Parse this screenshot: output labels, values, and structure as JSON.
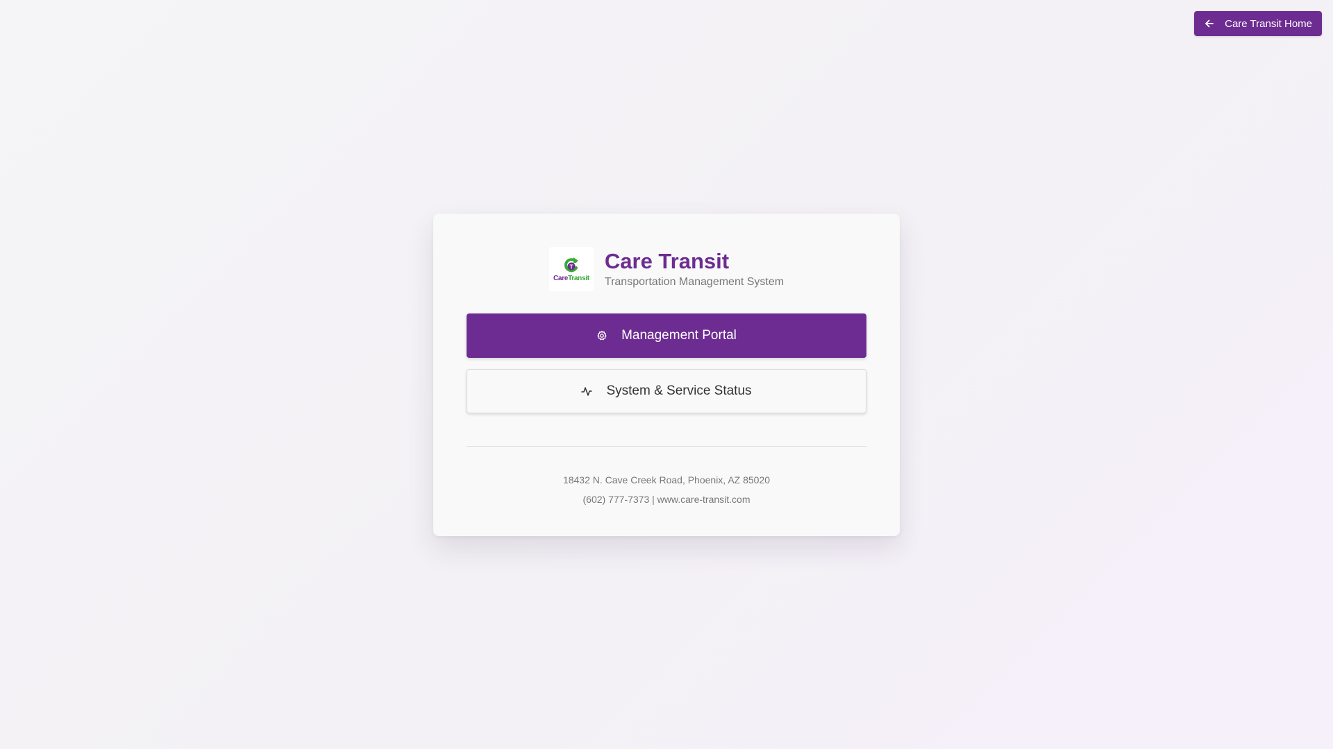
{
  "header": {
    "home_button_label": "Care Transit Home",
    "home_button_icon": "arrow-left-icon"
  },
  "brand": {
    "logo_text_care": "Care",
    "logo_text_transit": "Transit",
    "title": "Care Transit",
    "subtitle": "Transportation Management System"
  },
  "actions": {
    "management_portal": {
      "label": "Management Portal",
      "icon": "gear-icon"
    },
    "system_status": {
      "label": "System & Service Status",
      "icon": "activity-icon"
    }
  },
  "footer": {
    "address": "18432 N. Cave Creek Road, Phoenix, AZ 85020",
    "contact": "(602) 777-7373 | www.care-transit.com"
  },
  "colors": {
    "brand_purple": "#6d2c91",
    "brand_green": "#3aa935",
    "background": "#f5f4f6",
    "card": "#f9f9f9"
  }
}
